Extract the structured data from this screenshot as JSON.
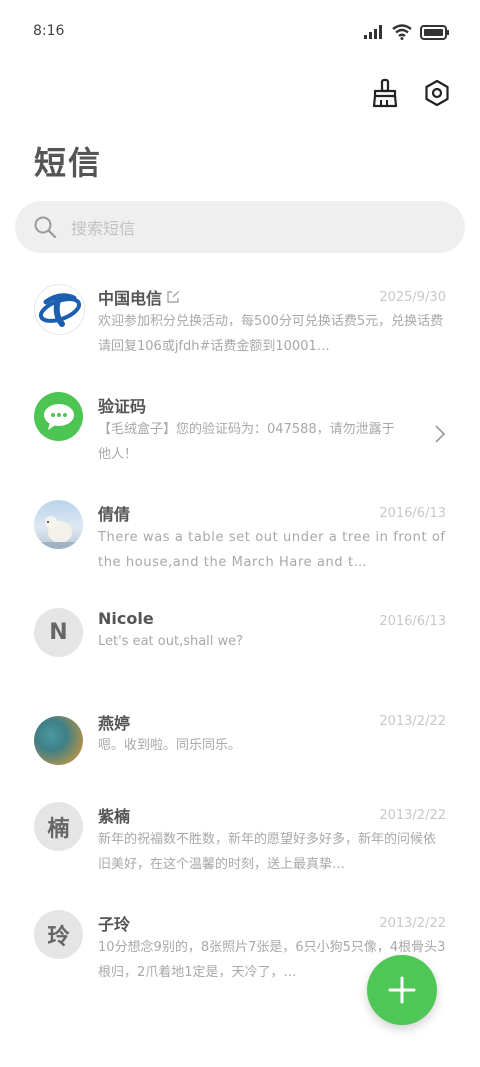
{
  "status_bar": {
    "time": "8:16"
  },
  "header": {
    "title": "短信",
    "brush_icon": "broom-icon",
    "settings_icon": "settings-icon"
  },
  "search": {
    "placeholder": "搜索短信"
  },
  "conversations": [
    {
      "name": "中国电信",
      "date": "2025/9/30",
      "preview": "欢迎参加积分兑换活动，每500分可兑换话费5元，兑换话费请回复106或jfdh#话费金额到10001…"
    },
    {
      "name": "验证码",
      "date": "",
      "preview": "【毛绒盒子】您的验证码为：047588，请勿泄露于他人！"
    },
    {
      "name": "倩倩",
      "date": "2016/6/13",
      "preview": "There was a table set out under a tree in front of the house,and the March Hare and t…"
    },
    {
      "name": "Nicole",
      "avatar_letter": "N",
      "date": "2016/6/13",
      "preview": "Let's eat out,shall we?"
    },
    {
      "name": "燕婷",
      "date": "2013/2/22",
      "preview": "嗯。收到啦。同乐同乐。"
    },
    {
      "name": "紫楠",
      "avatar_letter": "楠",
      "date": "2013/2/22",
      "preview": "新年的祝福数不胜数，新年的愿望好多好多，新年的问候依旧美好，在这个温馨的时刻，送上最真挚…"
    },
    {
      "name": "子玲",
      "avatar_letter": "玲",
      "date": "2013/2/22",
      "preview": "10分想念9别的，8张照片7张是，6只小狗5只像，4根骨头3根归，2爪着地1定是，天冷了，…"
    }
  ],
  "colors": {
    "accent": "#4fc756",
    "telecom_blue": "#1b5fb0"
  }
}
